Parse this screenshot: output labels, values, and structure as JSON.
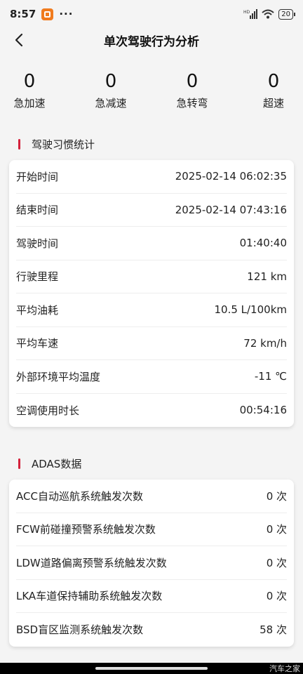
{
  "status": {
    "time": "8:57",
    "dots": "···",
    "battery": "20"
  },
  "header": {
    "title": "单次驾驶行为分析"
  },
  "stats": [
    {
      "value": "0",
      "label": "急加速"
    },
    {
      "value": "0",
      "label": "急减速"
    },
    {
      "value": "0",
      "label": "急转弯"
    },
    {
      "value": "0",
      "label": "超速"
    }
  ],
  "habits": {
    "title": "驾驶习惯统计",
    "rows": [
      {
        "key": "开始时间",
        "value": "2025-02-14 06:02:35"
      },
      {
        "key": "结束时间",
        "value": "2025-02-14 07:43:16"
      },
      {
        "key": "驾驶时间",
        "value": "01:40:40"
      },
      {
        "key": "行驶里程",
        "value": "121 km"
      },
      {
        "key": "平均油耗",
        "value": "10.5 L/100km"
      },
      {
        "key": "平均车速",
        "value": "72 km/h"
      },
      {
        "key": "外部环境平均温度",
        "value": "-11 ℃"
      },
      {
        "key": "空调使用时长",
        "value": "00:54:16"
      }
    ]
  },
  "adas": {
    "title": "ADAS数据",
    "rows": [
      {
        "key": "ACC自动巡航系统触发次数",
        "value": "0 次"
      },
      {
        "key": "FCW前碰撞预警系统触发次数",
        "value": "0 次"
      },
      {
        "key": "LDW道路偏离预警系统触发次数",
        "value": "0 次"
      },
      {
        "key": "LKA车道保持辅助系统触发次数",
        "value": "0 次"
      },
      {
        "key": "BSD盲区监测系统触发次数",
        "value": "58 次"
      }
    ]
  },
  "watermark": "汽车之家",
  "colors": {
    "accent": "#d4213b",
    "background": "#f4f4f4",
    "card": "#ffffff"
  }
}
